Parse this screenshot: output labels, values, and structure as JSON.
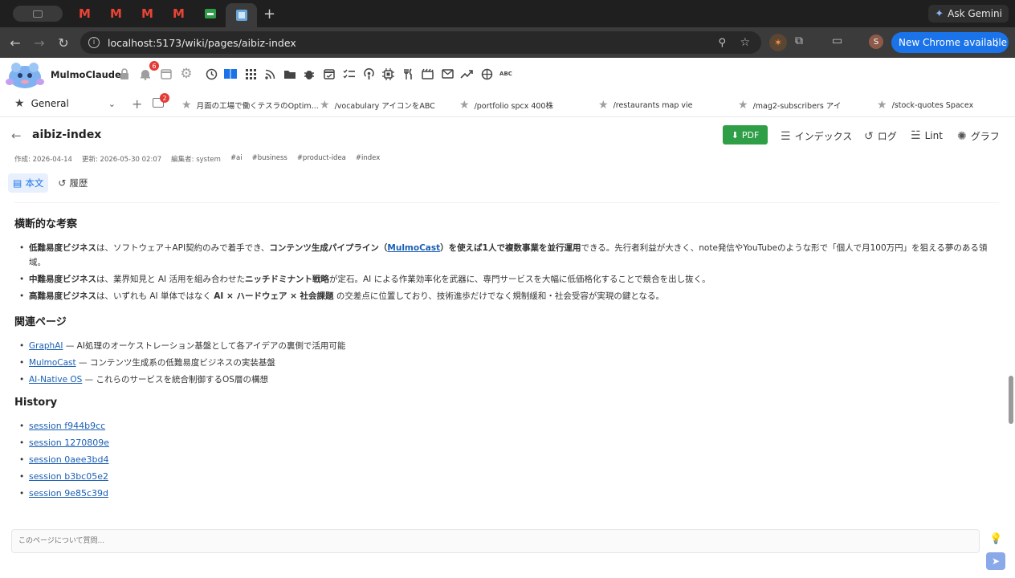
{
  "browser": {
    "tab_glyph": "M",
    "new_tab": "+",
    "gemini_label": "Ask Gemini",
    "url": "localhost:5173/wiki/pages/aibiz-index",
    "profile_initial": "S",
    "update_label": "New Chrome available"
  },
  "app": {
    "name": "MulmoClaude",
    "notifications_count": "6",
    "toolbar_abc": "ABC",
    "accent_color": "#1a73e8"
  },
  "workspace": {
    "name": "General",
    "drawer_count": "2",
    "pinned": [
      "月面の工場で働くテスラのOptim...",
      "/vocabulary アイコンをABC",
      "/portfolio spcx 400株",
      "/restaurants map vie",
      "/mag2-subscribers アイ",
      "/stock-quotes Spacex"
    ]
  },
  "page": {
    "title": "aibiz-index",
    "pdf_label": "PDF",
    "index_label": "インデックス",
    "log_label": "ログ",
    "lint_label": "Lint",
    "graph_label": "グラフ",
    "meta": {
      "created": "作成: 2026-04-14",
      "updated": "更新: 2026-05-30 02:07",
      "editor": "編集者: system"
    },
    "tags": [
      "#ai",
      "#business",
      "#product-idea",
      "#index"
    ],
    "view_tabs": {
      "body": "本文",
      "history": "履歴"
    }
  },
  "content": {
    "section1_title": "横断的な考察",
    "s1_items": [
      {
        "a_bold": "低難易度ビジネス",
        "a_text": "は、ソフトウェア＋API契約のみで着手でき、",
        "b_bold": "コンテンツ生成パイプライン（",
        "b_link": "MulmoCast",
        "b_bold2": "）を使えば1人で複数事業を並行運用",
        "c_text": "できる。先行者利益が大きく、note発信やYouTubeのような形で「個人で月100万円」を狙える夢のある領域。"
      },
      {
        "a_bold": "中難易度ビジネス",
        "a_text": "は、業界知見と AI 活用を組み合わせた",
        "b_bold": "ニッチドミナント戦略",
        "c_text": "が定石。AI による作業効率化を武器に、専門サービスを大幅に低価格化することで競合を出し抜く。"
      },
      {
        "a_bold": "高難易度ビジネス",
        "a_text": "は、いずれも AI 単体ではなく ",
        "b_bold": "AI × ハードウェア × 社会課題",
        "c_text": " の交差点に位置しており、技術進歩だけでなく規制緩和・社会受容が実現の鍵となる。"
      }
    ],
    "section2_title": "関連ページ",
    "related": [
      {
        "link": "GraphAI",
        "desc": " — AI処理のオーケストレーション基盤として各アイデアの裏側で活用可能"
      },
      {
        "link": "MulmoCast",
        "desc": " — コンテンツ生成系の低難易度ビジネスの実装基盤"
      },
      {
        "link": "AI-Native OS",
        "desc": " — これらのサービスを統合制御するOS層の構想"
      }
    ],
    "section3_title": "History",
    "history": [
      "session f944b9cc",
      "session 1270809e",
      "session 0aee3bd4",
      "session b3bc05e2",
      "session 9e85c39d"
    ]
  },
  "chat": {
    "placeholder": "このページについて質問..."
  }
}
